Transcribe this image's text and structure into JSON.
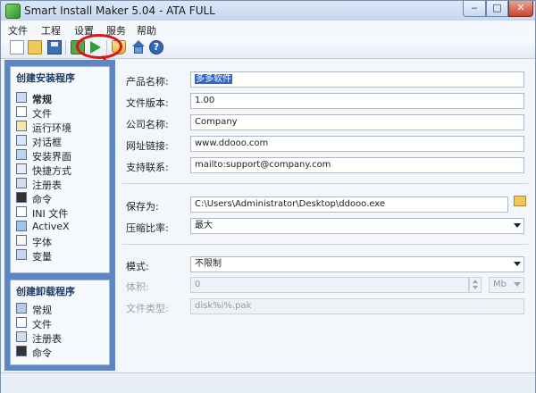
{
  "window": {
    "title": "Smart Install Maker 5.04 - ATA FULL",
    "min": "‒",
    "max": "□",
    "close": "✕"
  },
  "menu": [
    "文件",
    "工程",
    "设置",
    "服务",
    "帮助"
  ],
  "toolbar": {
    "help_glyph": "?",
    "icons": [
      "new-file-icon",
      "open-folder-icon",
      "save-icon",
      "build-icon",
      "run-icon",
      "clean-icon",
      "home-icon",
      "help-icon"
    ]
  },
  "sidebar": {
    "install_title": "创建安装程序",
    "install_items": [
      {
        "label": "常规",
        "icon": "general-icon"
      },
      {
        "label": "文件",
        "icon": "files-icon"
      },
      {
        "label": "运行环境",
        "icon": "environment-icon"
      },
      {
        "label": "对话框",
        "icon": "dialog-icon"
      },
      {
        "label": "安装界面",
        "icon": "interface-icon"
      },
      {
        "label": "快捷方式",
        "icon": "shortcut-icon"
      },
      {
        "label": "注册表",
        "icon": "registry-icon"
      },
      {
        "label": "命令",
        "icon": "command-icon"
      },
      {
        "label": "INI 文件",
        "icon": "ini-icon"
      },
      {
        "label": "ActiveX",
        "icon": "activex-icon"
      },
      {
        "label": "字体",
        "icon": "font-icon"
      },
      {
        "label": "变量",
        "icon": "variable-icon"
      }
    ],
    "uninstall_title": "创建卸载程序",
    "uninstall_items": [
      {
        "label": "常规",
        "icon": "general-icon"
      },
      {
        "label": "文件",
        "icon": "files-icon"
      },
      {
        "label": "注册表",
        "icon": "registry-icon"
      },
      {
        "label": "命令",
        "icon": "command-icon"
      }
    ]
  },
  "form": {
    "product_name_label": "产品名称:",
    "product_name_value": "多多软件",
    "version_label": "文件版本:",
    "version_value": "1.00",
    "company_label": "公司名称:",
    "company_value": "Company",
    "website_label": "网址链接:",
    "website_value": "www.ddooo.com",
    "support_label": "支持联系:",
    "support_value": "mailto:support@company.com",
    "save_as_label": "保存为:",
    "save_as_value": "C:\\Users\\Administrator\\Desktop\\ddooo.exe",
    "compression_label": "压缩比率:",
    "compression_value": "最大",
    "mode_label": "模式:",
    "mode_value": "不限制",
    "volume_label": "体积:",
    "volume_value": "0",
    "volume_unit": "Mb",
    "file_type_label": "文件类型:",
    "file_type_value": "disk%i%.pak"
  },
  "colors": {
    "sidebar_bg": "#5f86c4",
    "annotation_red": "#e01212",
    "selection_blue": "#3468c6"
  }
}
